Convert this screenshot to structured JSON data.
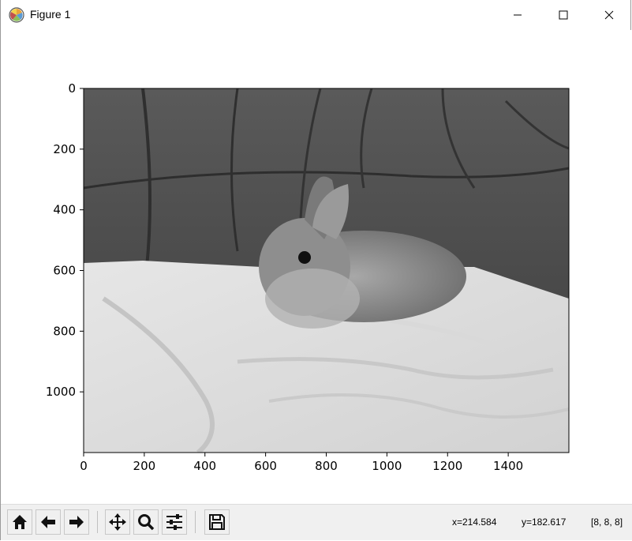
{
  "window": {
    "title": "Figure 1",
    "app_icon": "matplotlib-icon",
    "controls": [
      "minimize-icon",
      "maximize-icon",
      "close-icon"
    ]
  },
  "chart_data": {
    "type": "image",
    "description_of_content": "",
    "colormap": "gray",
    "image_shape": [
      1200,
      1600
    ],
    "xlim": [
      0,
      1600
    ],
    "ylim": [
      1200,
      0
    ],
    "x_ticks": [
      "0",
      "200",
      "400",
      "600",
      "800",
      "1000",
      "1200",
      "1400"
    ],
    "y_ticks": [
      "0",
      "200",
      "400",
      "600",
      "800",
      "1000"
    ],
    "x_tick_values": [
      0,
      200,
      400,
      600,
      800,
      1000,
      1200,
      1400
    ],
    "y_tick_values": [
      0,
      200,
      400,
      600,
      800,
      1000
    ]
  },
  "toolbar": {
    "buttons": [
      "home-icon",
      "back-icon",
      "forward-icon",
      "pan-icon",
      "zoom-icon",
      "configure-subplots-icon",
      "save-icon"
    ],
    "status_x": "x=214.584",
    "status_y": "y=182.617",
    "status_pixel": "[8, 8, 8]"
  }
}
